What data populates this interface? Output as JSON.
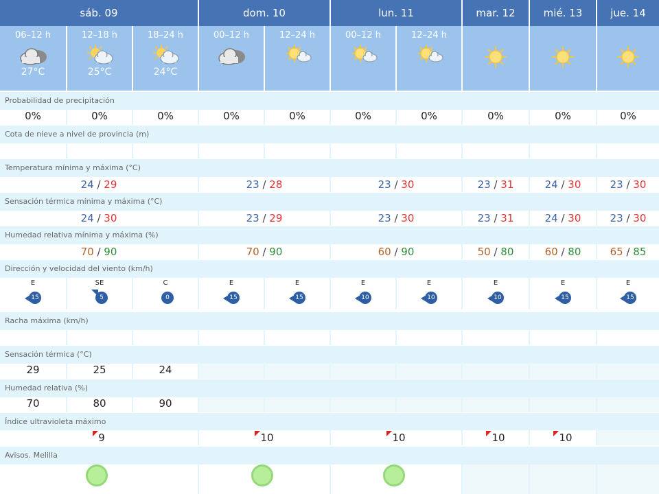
{
  "days": [
    {
      "label": "sáb. 09"
    },
    {
      "label": "dom. 10"
    },
    {
      "label": "lun. 11"
    },
    {
      "label": "mar. 12"
    },
    {
      "label": "mié. 13"
    },
    {
      "label": "jue. 14"
    }
  ],
  "periods": [
    {
      "time": "06–12 h",
      "temp": "27°C",
      "icon": "cloudy-icon"
    },
    {
      "time": "12–18 h",
      "temp": "25°C",
      "icon": "partly-cloudy-icon"
    },
    {
      "time": "18–24 h",
      "temp": "24°C",
      "icon": "partly-cloudy-icon"
    },
    {
      "time": "00–12 h",
      "temp": "",
      "icon": "cloudy-icon"
    },
    {
      "time": "12–24 h",
      "temp": "",
      "icon": "sun-cloud-icon"
    },
    {
      "time": "00–12 h",
      "temp": "",
      "icon": "sun-cloud-icon"
    },
    {
      "time": "12–24 h",
      "temp": "",
      "icon": "sun-cloud-icon"
    },
    {
      "time": "",
      "temp": "",
      "icon": "sun-icon"
    },
    {
      "time": "",
      "temp": "",
      "icon": "sun-icon"
    },
    {
      "time": "",
      "temp": "",
      "icon": "sun-icon"
    }
  ],
  "rows": {
    "precip_label": "Probabilidad de precipitación",
    "precip": [
      "0%",
      "0%",
      "0%",
      "0%",
      "0%",
      "0%",
      "0%",
      "0%",
      "0%",
      "0%"
    ],
    "snow_label": "Cota de nieve a nivel de provincia (m)",
    "temp_label": "Temperatura mínima y máxima (°C)",
    "temp": [
      {
        "min": "24",
        "max": "29"
      },
      {
        "min": "23",
        "max": "28"
      },
      {
        "min": "23",
        "max": "30"
      },
      {
        "min": "23",
        "max": "31"
      },
      {
        "min": "24",
        "max": "30"
      },
      {
        "min": "23",
        "max": "30"
      }
    ],
    "feels_label": "Sensación térmica mínima y máxima (°C)",
    "feels": [
      {
        "min": "24",
        "max": "30"
      },
      {
        "min": "23",
        "max": "29"
      },
      {
        "min": "23",
        "max": "30"
      },
      {
        "min": "23",
        "max": "31"
      },
      {
        "min": "24",
        "max": "30"
      },
      {
        "min": "23",
        "max": "30"
      }
    ],
    "hum_label": "Humedad relativa mínima y máxima (%)",
    "hum": [
      {
        "min": "70",
        "max": "90"
      },
      {
        "min": "70",
        "max": "90"
      },
      {
        "min": "60",
        "max": "90"
      },
      {
        "min": "50",
        "max": "80"
      },
      {
        "min": "60",
        "max": "80"
      },
      {
        "min": "65",
        "max": "85"
      }
    ],
    "wind_label": "Dirección y velocidad del viento (km/h)",
    "wind": [
      {
        "dir": "E",
        "speed": "15"
      },
      {
        "dir": "SE",
        "speed": "5"
      },
      {
        "dir": "C",
        "speed": "0"
      },
      {
        "dir": "E",
        "speed": "15"
      },
      {
        "dir": "E",
        "speed": "15"
      },
      {
        "dir": "E",
        "speed": "10"
      },
      {
        "dir": "E",
        "speed": "10"
      },
      {
        "dir": "E",
        "speed": "10"
      },
      {
        "dir": "E",
        "speed": "15"
      },
      {
        "dir": "E",
        "speed": "15"
      }
    ],
    "gust_label": "Racha máxima (km/h)",
    "st_label": "Sensación térmica (°C)",
    "st": [
      "29",
      "25",
      "24"
    ],
    "rh_label": "Humedad relativa (%)",
    "rh": [
      "70",
      "80",
      "90"
    ],
    "uv_label": "Índice ultravioleta máximo",
    "uv": [
      "9",
      "10",
      "10",
      "10",
      "10"
    ],
    "warn_label": "Avisos. Melilla"
  },
  "colors": {
    "header": "#4673b4",
    "period_bg": "#9cc3ec",
    "row_bg": "#e2f4fb",
    "min_temp": "#3d64a8",
    "max_temp": "#dd3333",
    "min_hum": "#b0622a",
    "max_hum": "#2e8b3a",
    "wind_badge": "#2e5ea3",
    "warning_green": "#b6ee9a"
  }
}
